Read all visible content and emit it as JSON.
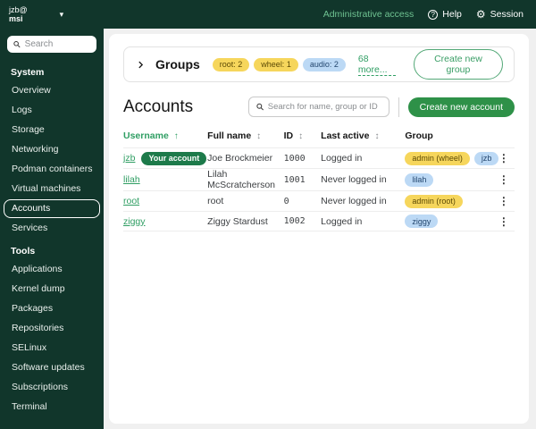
{
  "masthead": {
    "user": {
      "line1": "jzb@",
      "line2": "msi"
    },
    "admin_access": "Administrative access",
    "help": "Help",
    "session": "Session"
  },
  "sidebar": {
    "search_placeholder": "Search",
    "sections": [
      {
        "heading": "System",
        "items": [
          {
            "label": "Overview",
            "active": false
          },
          {
            "label": "Logs",
            "active": false
          },
          {
            "label": "Storage",
            "active": false
          },
          {
            "label": "Networking",
            "active": false
          },
          {
            "label": "Podman containers",
            "active": false
          },
          {
            "label": "Virtual machines",
            "active": false
          },
          {
            "label": "Accounts",
            "active": true
          },
          {
            "label": "Services",
            "active": false
          }
        ]
      },
      {
        "heading": "Tools",
        "items": [
          {
            "label": "Applications",
            "active": false
          },
          {
            "label": "Kernel dump",
            "active": false
          },
          {
            "label": "Packages",
            "active": false
          },
          {
            "label": "Repositories",
            "active": false
          },
          {
            "label": "SELinux",
            "active": false
          },
          {
            "label": "Software updates",
            "active": false
          },
          {
            "label": "Subscriptions",
            "active": false
          },
          {
            "label": "Terminal",
            "active": false
          }
        ]
      }
    ]
  },
  "groups_panel": {
    "title": "Groups",
    "badges": [
      {
        "label": "root: 2",
        "color": "gold"
      },
      {
        "label": "wheel: 1",
        "color": "gold"
      },
      {
        "label": "audio: 2",
        "color": "blue"
      }
    ],
    "more_link": "68 more...",
    "create_button": "Create new group"
  },
  "accounts": {
    "title": "Accounts",
    "search_placeholder": "Search for name, group or ID",
    "create_button": "Create new account",
    "table": {
      "headers": {
        "username": "Username",
        "full_name": "Full name",
        "id": "ID",
        "last_active": "Last active",
        "group": "Group"
      },
      "sort": {
        "active_column": "username",
        "direction": "asc"
      },
      "rows": [
        {
          "username": "jzb",
          "badge": "Your account",
          "full_name": "Joe Brockmeier",
          "id": "1000",
          "last_active": "Logged in",
          "groups": [
            {
              "label": "admin (wheel)",
              "color": "gold"
            },
            {
              "label": "jzb",
              "color": "blue"
            }
          ]
        },
        {
          "username": "lilah",
          "badge": null,
          "full_name": "Lilah McScratcherson",
          "id": "1001",
          "last_active": "Never logged in",
          "groups": [
            {
              "label": "lilah",
              "color": "blue"
            }
          ]
        },
        {
          "username": "root",
          "badge": null,
          "full_name": "root",
          "id": "0",
          "last_active": "Never logged in",
          "groups": [
            {
              "label": "admin (root)",
              "color": "gold"
            }
          ]
        },
        {
          "username": "ziggy",
          "badge": null,
          "full_name": "Ziggy Stardust",
          "id": "1002",
          "last_active": "Logged in",
          "groups": [
            {
              "label": "ziggy",
              "color": "blue"
            }
          ]
        }
      ]
    }
  },
  "colors": {
    "masthead_bg": "#11362b",
    "link_on_dark": "#6fc392",
    "link_green": "#2f9e63",
    "primary_button": "#2e9148",
    "badge_gold_bg": "#f6d65c",
    "badge_gold_text": "#5c4a05",
    "badge_blue_bg": "#bcd9f5",
    "badge_blue_text": "#23466e",
    "your_account_badge_bg": "#1d7a4a"
  }
}
